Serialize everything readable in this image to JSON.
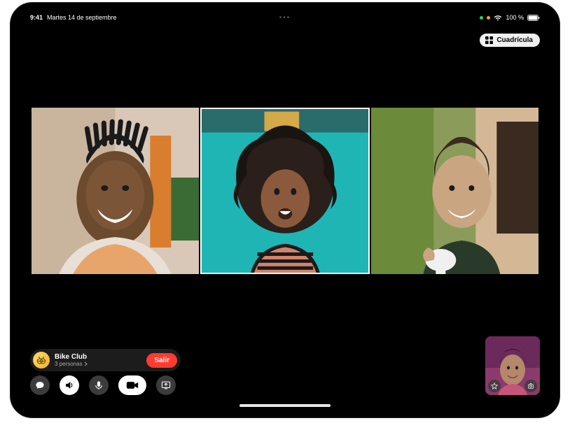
{
  "status": {
    "time": "9:41",
    "date": "Martes 14 de septiembre",
    "battery_text": "100 %"
  },
  "grid_button": {
    "label": "Cuadrícula"
  },
  "participants": [
    {
      "id": "p1",
      "active": false
    },
    {
      "id": "p2",
      "active": true
    },
    {
      "id": "p3",
      "active": false
    }
  ],
  "call": {
    "name": "Bike Club",
    "subtitle": "3 personas",
    "leave_label": "Salir"
  },
  "controls": {
    "messages": "messages",
    "speaker": "speaker",
    "mic": "mic",
    "camera": "camera",
    "share": "share-screen"
  }
}
